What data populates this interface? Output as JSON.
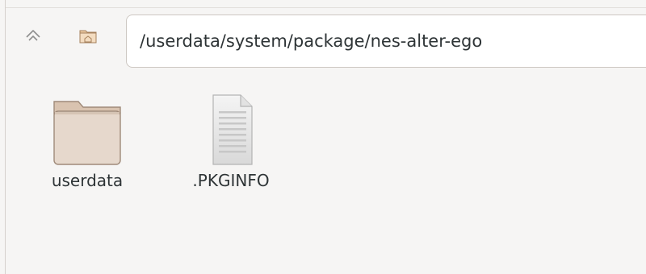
{
  "toolbar": {
    "up_icon": "go-up-icon",
    "home_icon": "home-folder-icon",
    "location_path": "/userdata/system/package/nes-alter-ego"
  },
  "files": [
    {
      "name": "userdata",
      "type": "folder",
      "icon": "folder-icon"
    },
    {
      "name": ".PKGINFO",
      "type": "text-file",
      "icon": "text-file-icon"
    }
  ],
  "colors": {
    "background": "#f6f5f4",
    "folder_fill": "#e6d8cc",
    "folder_stroke": "#9f8a79",
    "document_fill": "#ececec",
    "text": "#2e3436"
  }
}
